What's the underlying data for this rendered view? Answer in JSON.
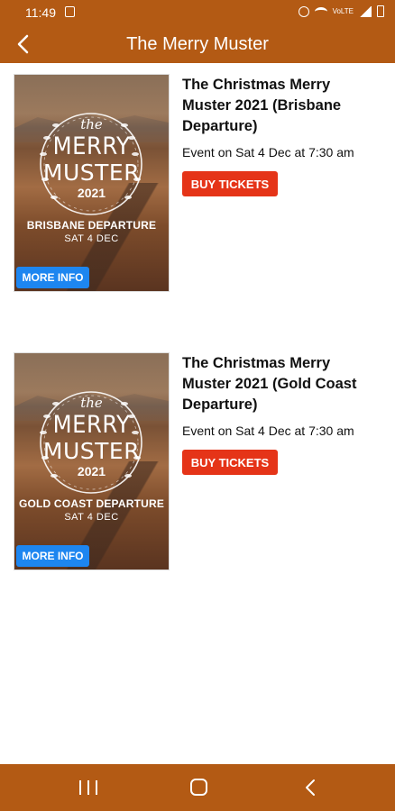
{
  "status_bar": {
    "time": "11:49",
    "network_label": "VoLTE"
  },
  "header": {
    "title": "The Merry Muster"
  },
  "events": [
    {
      "title": "The Christmas Merry Muster 2021 (Brisbane Departure)",
      "date_text": "Event on Sat 4 Dec at 7:30 am",
      "buy_label": "BUY TICKETS",
      "poster": {
        "the": "the",
        "merry": "MERRY",
        "muster": "MUSTER",
        "year": "2021",
        "departure": "BRISBANE DEPARTURE",
        "date": "SAT 4 DEC"
      },
      "more_info_label": "MORE INFO"
    },
    {
      "title": "The Christmas Merry Muster 2021 (Gold Coast Departure)",
      "date_text": "Event on Sat 4 Dec at 7:30 am",
      "buy_label": "BUY TICKETS",
      "poster": {
        "the": "the",
        "merry": "MERRY",
        "muster": "MUSTER",
        "year": "2021",
        "departure": "GOLD COAST DEPARTURE",
        "date": "SAT 4 DEC"
      },
      "more_info_label": "MORE INFO"
    }
  ],
  "colors": {
    "brand": "#b35a14",
    "buy_button": "#e53418",
    "more_info_button": "#1d86f0"
  },
  "icons": {
    "back": "back-arrow-icon",
    "nav_recents": "recents-icon",
    "nav_home": "home-icon",
    "nav_back": "nav-back-icon"
  }
}
